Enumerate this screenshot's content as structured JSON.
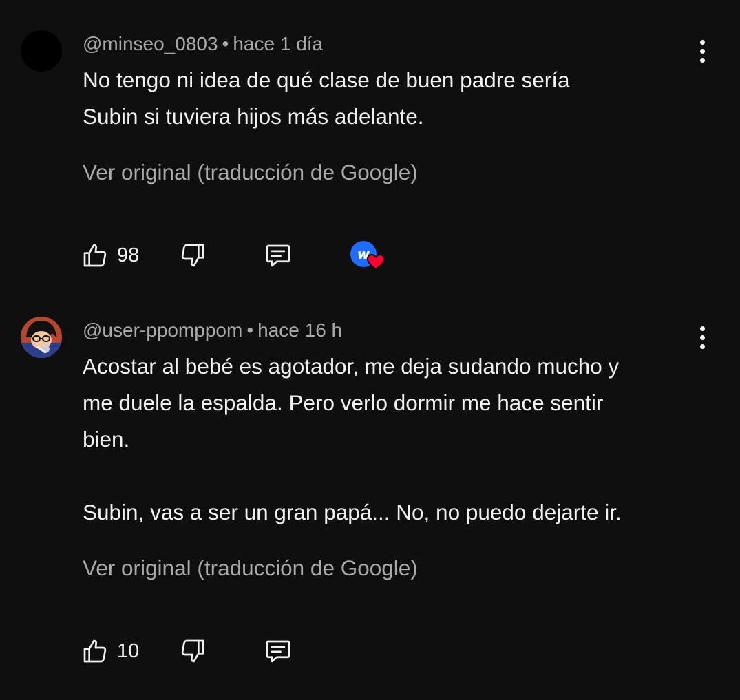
{
  "comments": [
    {
      "handle": "@minseo_0803",
      "separator": "•",
      "time": "hace 1 día",
      "lines": [
        "No tengo ni idea de qué clase de buen padre sería",
        "Subin si tuviera hijos más adelante."
      ],
      "translate_label": "Ver original (traducción de Google)",
      "likes": "98",
      "creator_heart": true,
      "avatar": "black-circle"
    },
    {
      "handle": "@user-ppomppom",
      "separator": "•",
      "time": "hace 16 h",
      "lines": [
        "Acostar al bebé es agotador, me deja sudando mucho y",
        "me duele la espalda. Pero verlo dormir me hace sentir",
        "bien.",
        "Subin, vas a ser un gran papá... No, no puedo dejarte ir."
      ],
      "translate_label": "Ver original (traducción de Google)",
      "likes": "10",
      "creator_heart": false,
      "avatar": "anime-character"
    }
  ],
  "icons": {
    "like": "thumbs-up-icon",
    "dislike": "thumbs-down-icon",
    "reply": "reply-icon",
    "more": "more-vert-icon",
    "heart": "creator-heart-icon"
  },
  "colors": {
    "background": "#0f0f0f",
    "text": "#f1f1f1",
    "secondary": "#aaaaaa",
    "heart": "#ff0033",
    "creator_badge": "#1f6dff"
  }
}
